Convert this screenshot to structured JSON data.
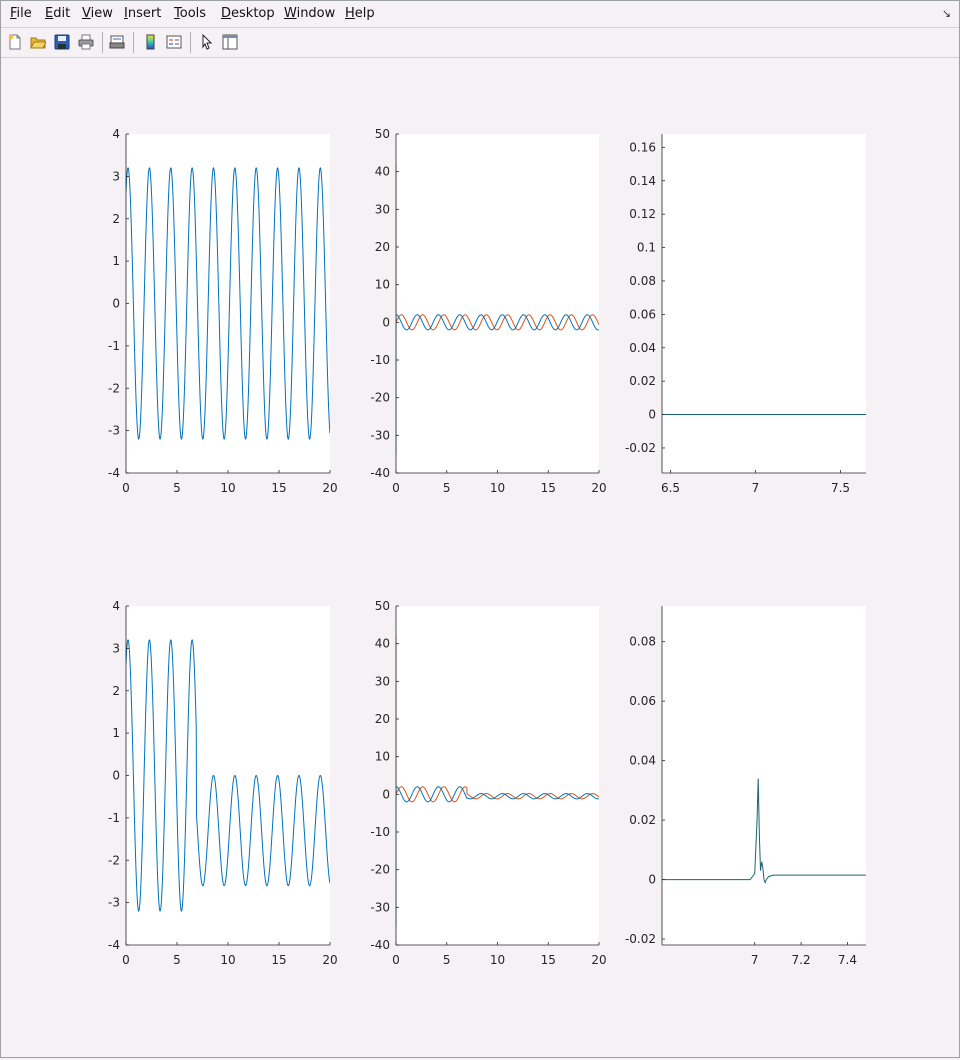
{
  "menu": [
    {
      "key": "F",
      "rest": "ile"
    },
    {
      "key": "E",
      "rest": "dit"
    },
    {
      "key": "V",
      "rest": "iew"
    },
    {
      "key": "I",
      "rest": "nsert"
    },
    {
      "key": "T",
      "rest": "ools"
    },
    {
      "key": "D",
      "rest": "esktop"
    },
    {
      "key": "W",
      "rest": "indow"
    },
    {
      "key": "H",
      "rest": "elp"
    }
  ],
  "toolbar": {
    "buttons": [
      "new-figure-icon",
      "open-file-icon",
      "save-icon",
      "print-icon",
      "print-preview-icon",
      "colorbar-icon",
      "legend-icon",
      "pointer-icon",
      "property-editor-icon"
    ]
  },
  "colors": {
    "series1": "#0072bd",
    "series2": "#d95319",
    "series3": "#1a6470"
  },
  "chart_data": [
    {
      "id": "p11",
      "type": "line",
      "grid": false,
      "xlim": [
        0,
        20
      ],
      "ylim": [
        -4,
        4
      ],
      "xticks": [
        "0",
        "5",
        "10",
        "15",
        "20"
      ],
      "yticks": [
        "-4",
        "-3",
        "-2",
        "-1",
        "0",
        "1",
        "2",
        "3",
        "4"
      ],
      "series": [
        {
          "formula": "y = 3.2*cos(3*x - 0.6)",
          "x_range": [
            0,
            20
          ],
          "samples": 900
        }
      ]
    },
    {
      "id": "p12",
      "type": "line",
      "grid": false,
      "xlim": [
        0,
        20
      ],
      "ylim": [
        -40,
        50
      ],
      "xticks": [
        "0",
        "5",
        "10",
        "15",
        "20"
      ],
      "yticks": [
        "-40",
        "-30",
        "-20",
        "-10",
        "0",
        "10",
        "20",
        "30",
        "40",
        "50"
      ],
      "series": [
        {
          "formula": "y = 2*sin(3*x)",
          "x_range": [
            0,
            20
          ],
          "samples": 900,
          "initial_spike": [
            0,
            42
          ]
        },
        {
          "formula": "y = 2*cos(3*x)",
          "x_range": [
            0,
            20
          ],
          "samples": 900,
          "initial_spike": [
            0,
            -35
          ]
        }
      ]
    },
    {
      "id": "p13",
      "type": "line",
      "grid": false,
      "xlim": [
        6.45,
        7.65
      ],
      "ylim": [
        -0.035,
        0.168
      ],
      "xticks": [
        "6.5",
        "7",
        "7.5"
      ],
      "yticks": [
        "-0.02",
        "0",
        "0.02",
        "0.04",
        "0.06",
        "0.08",
        "0.1",
        "0.12",
        "0.14",
        "0.16"
      ],
      "series": [
        {
          "x": [
            6.45,
            7.65
          ],
          "y": [
            0,
            0
          ]
        }
      ]
    },
    {
      "id": "p21",
      "type": "line",
      "grid": false,
      "xlim": [
        0,
        20
      ],
      "ylim": [
        -4,
        4
      ],
      "xticks": [
        "0",
        "5",
        "10",
        "15",
        "20"
      ],
      "yticks": [
        "-4",
        "-3",
        "-2",
        "-1",
        "0",
        "1",
        "2",
        "3",
        "4"
      ],
      "series": [
        {
          "formula": "y = 3.2*cos(3*x - 0.6) for x < 6.9; y = -1.3 + 1.3*cos(3*x - 0.6) after",
          "x_range": [
            0,
            20
          ],
          "samples": 900
        }
      ]
    },
    {
      "id": "p22",
      "type": "line",
      "grid": false,
      "xlim": [
        0,
        20
      ],
      "ylim": [
        -40,
        50
      ],
      "xticks": [
        "0",
        "5",
        "10",
        "15",
        "20"
      ],
      "yticks": [
        "-40",
        "-30",
        "-20",
        "-10",
        "0",
        "10",
        "20",
        "30",
        "40",
        "50"
      ],
      "series": [
        {
          "formula": "y = 2*sin(3*x) for x < 7; y = -0.5 + 0.7*sin(3*x) after",
          "x_range": [
            0,
            20
          ],
          "samples": 900,
          "initial_spike": [
            0,
            42
          ]
        },
        {
          "formula": "y = 2*cos(3*x) for x < 7; y = -0.5 + 0.7*cos(3*x) after",
          "x_range": [
            0,
            20
          ],
          "samples": 900,
          "initial_spike": [
            0,
            -35
          ]
        }
      ]
    },
    {
      "id": "p23",
      "type": "line",
      "grid": false,
      "xlim": [
        6.6,
        7.48
      ],
      "ylim": [
        -0.022,
        0.092
      ],
      "xticks": [
        "7",
        "7.2",
        "7.4"
      ],
      "yticks": [
        "-0.02",
        "0",
        "0.02",
        "0.04",
        "0.06",
        "0.08"
      ],
      "series": [
        {
          "x": [
            6.6,
            6.98,
            7.0,
            7.01,
            7.015,
            7.02,
            7.025,
            7.03,
            7.035,
            7.04,
            7.045,
            7.05,
            7.06,
            7.08,
            7.48
          ],
          "y": [
            0,
            0,
            0.002,
            0.02,
            0.034,
            0.015,
            0.003,
            0.006,
            0.004,
            0.0,
            -0.001,
            0.0,
            0.001,
            0.0015,
            0.0015
          ]
        }
      ]
    }
  ]
}
